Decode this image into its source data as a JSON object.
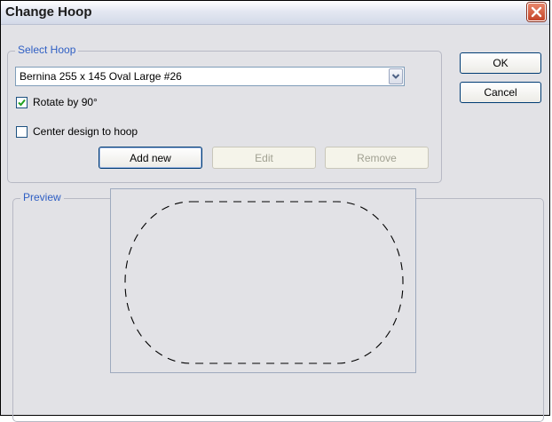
{
  "window": {
    "title": "Change Hoop"
  },
  "select_hoop": {
    "group_label": "Select Hoop",
    "dropdown_value": "Bernina 255 x 145 Oval Large #26",
    "rotate_label": "Rotate by 90°",
    "rotate_checked": true,
    "center_label": "Center design to hoop",
    "center_checked": false,
    "add_new_label": "Add new",
    "edit_label": "Edit",
    "remove_label": "Remove"
  },
  "buttons": {
    "ok_label": "OK",
    "cancel_label": "Cancel"
  },
  "preview": {
    "group_label": "Preview"
  },
  "icons": {
    "close": "close-icon",
    "dropdown_arrow": "chevron-down-icon",
    "check": "checkmark-icon",
    "hoop_outline": "oval-hoop-outline"
  },
  "colors": {
    "group_label": "#2f5fc4",
    "close_button": "#c4452a",
    "checkmark": "#21a121",
    "hoop_outline": "#000000"
  }
}
